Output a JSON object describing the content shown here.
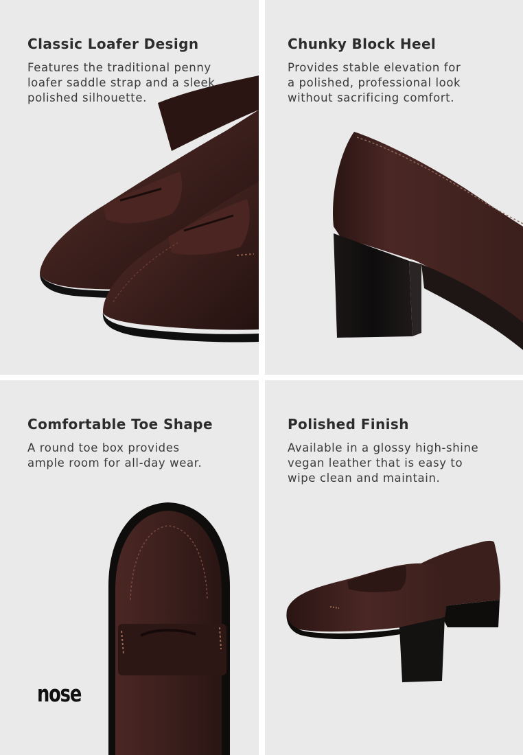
{
  "panels": [
    {
      "title": "Classic Loafer Design",
      "description_lines": [
        "Features the traditional penny",
        "loafer saddle strap and a sleek,",
        "polished silhouette."
      ]
    },
    {
      "title": "Chunky Block Heel",
      "description_lines": [
        "Provides stable elevation for",
        "a polished, professional look",
        "without sacrificing comfort."
      ]
    },
    {
      "title": "Comfortable Toe Shape",
      "description_lines": [
        "A round toe box provides",
        "ample room for all-day wear."
      ]
    },
    {
      "title": "Polished Finish",
      "description_lines": [
        "Available in a glossy high-shine",
        "vegan leather that is easy to",
        "wipe clean and maintain."
      ]
    }
  ],
  "brand": {
    "logo_text": "nose"
  },
  "colors": {
    "panel_background": "#ebeaeb",
    "leather": "#3b1f1c",
    "heel": "#141111",
    "text": "#2c2c2c"
  }
}
